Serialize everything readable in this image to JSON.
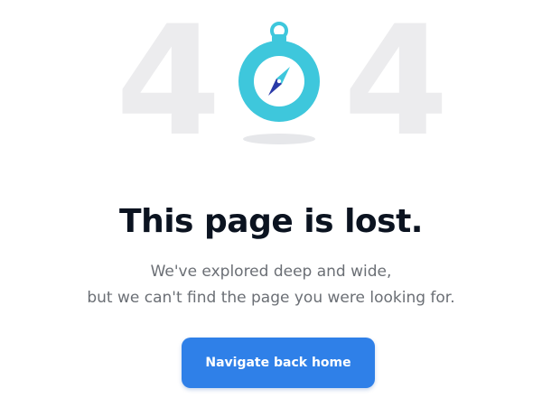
{
  "error_display": {
    "digit_left": "4",
    "digit_right": "4",
    "center_icon": "compass-icon",
    "digit_color": "#ececee",
    "compass_color": "#3ec7dc"
  },
  "message": {
    "title": "This page is lost.",
    "line1": "We've explored deep and wide,",
    "line2": "but we can't find the page you were looking for."
  },
  "actions": {
    "home_button_label": "Navigate back home",
    "accent_color": "#2f80e8"
  }
}
